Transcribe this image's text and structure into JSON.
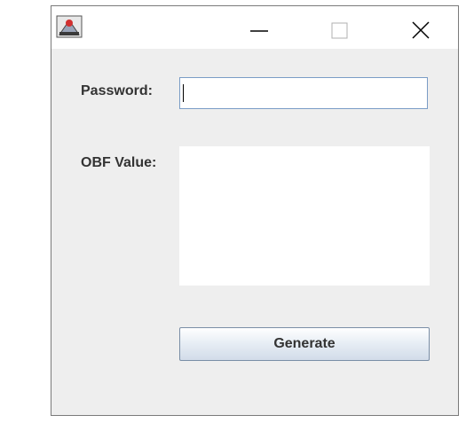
{
  "window": {
    "icon": "java-app-icon",
    "controls": {
      "minimize_icon": "minimize-icon",
      "maximize_icon": "maximize-icon",
      "close_icon": "close-icon"
    }
  },
  "form": {
    "password_label": "Password:",
    "password_value": "",
    "obf_label": "OBF Value:",
    "obf_value": "",
    "generate_label": "Generate"
  },
  "colors": {
    "window_bg": "#eeeeee",
    "titlebar_bg": "#ffffff",
    "field_border": "#7a9cc6",
    "label_text": "#333333"
  }
}
